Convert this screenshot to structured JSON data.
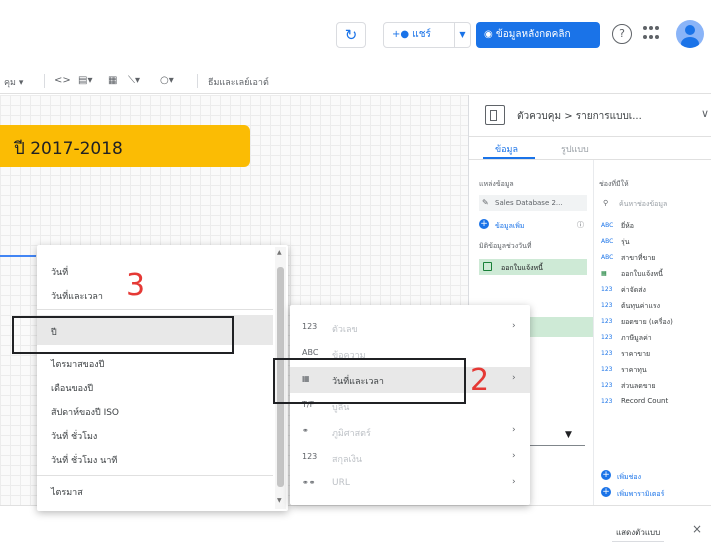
{
  "topbar": {
    "refresh_icon": "refresh-icon",
    "share_label": "แชร์",
    "view_mode_label": "ข้อมูลหลังกดคลิก",
    "help_icon": "help-icon",
    "apps_icon": "apps-grid-icon",
    "avatar_icon": "account-avatar"
  },
  "toolbar": {
    "item_left": "คุม ▾",
    "code_icon": "<>",
    "chart_add_icon": "add-chart-icon",
    "grid_icon": "grid-icon",
    "line_icon": "line-icon",
    "shape_icon": "shape-icon",
    "theme_label": "ธีมและเลย์เอาต์"
  },
  "canvas": {
    "title": "ปี 2017-2018"
  },
  "panel": {
    "header_title": "ตัวควบคุม > รายการแบบเ...",
    "tab_data": "ข้อมูล",
    "tab_style": "รูปแบบ",
    "source_label": "แหล่งข้อมูล",
    "source_name": "Sales Database 2...",
    "add_data": "ข้อมูลเพิ่ม",
    "date_range_label": "มิติข้อมูลช่วงวันที่",
    "date_field": "ออกใบแจ้งหนี้",
    "available_fields_label": "ช่องที่มีให้",
    "search_placeholder": "ค้นหาช่องข้อมูล",
    "fields": [
      {
        "type": "ABC",
        "label": "ยี่ห้อ"
      },
      {
        "type": "ABC",
        "label": "รุ่น"
      },
      {
        "type": "ABC",
        "label": "สาขาที่ขาย"
      },
      {
        "type": "CAL",
        "label": "ออกใบแจ้งหนี้"
      },
      {
        "type": "123",
        "label": "ค่าจัดส่ง"
      },
      {
        "type": "123",
        "label": "ต้นทุนค่าแรง"
      },
      {
        "type": "123",
        "label": "ยอดขาย (เครื่อง)"
      },
      {
        "type": "123",
        "label": "ภาษีมูลค่า"
      },
      {
        "type": "123",
        "label": "ราคาขาย"
      },
      {
        "type": "123",
        "label": "ราคาทุน"
      },
      {
        "type": "123",
        "label": "ส่วนลดขาย"
      },
      {
        "type": "123",
        "label": "Record Count"
      }
    ],
    "add_field": "เพิ่มช่อง",
    "add_param": "เพิ่มพารามิเตอร์"
  },
  "bottom": {
    "reset_label": "แสดงตัวแบบ",
    "close_label": "×"
  },
  "menu1": {
    "items": [
      "วันที่",
      "วันที่และเวลา",
      "ปี",
      "ไตรมาสของปี",
      "เดือนของปี",
      "สัปดาห์ของปี ISO",
      "วันที่ ชั่วโมง",
      "วันที่ ชั่วโมง นาที",
      "ไตรมาส"
    ]
  },
  "menu2": {
    "items": [
      {
        "icon": "123",
        "label": "ตัวเลข"
      },
      {
        "icon": "ABC",
        "label": "ข้อความ"
      },
      {
        "icon": "calendar-icon",
        "label": "วันที่และเวลา"
      },
      {
        "icon": "T/F",
        "label": "บูลีน"
      },
      {
        "icon": "globe-icon",
        "label": "ภูมิศาสตร์"
      },
      {
        "icon": "123",
        "label": "สกุลเงิน"
      },
      {
        "icon": "link-icon",
        "label": "URL"
      }
    ]
  },
  "annotations": {
    "step_2": "2",
    "step_3": "3"
  },
  "colors": {
    "accent": "#1a73e8",
    "title_fill": "#fbbc04",
    "annotation_red": "#e53935",
    "date_green": "#ceead6"
  }
}
